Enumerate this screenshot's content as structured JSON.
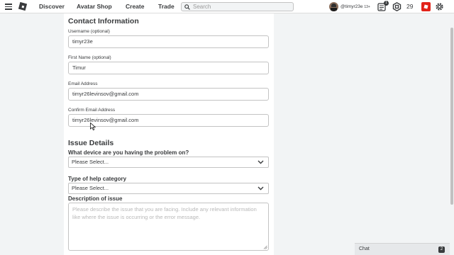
{
  "topbar": {
    "nav": [
      "Discover",
      "Avatar Shop",
      "Create",
      "Trade"
    ],
    "search_placeholder": "Search",
    "username": "@timyr23e",
    "age_label": "13+",
    "notification_count": "1",
    "robux": "29"
  },
  "contact": {
    "title": "Contact Information",
    "username_label": "Username (optional)",
    "username_value": "timyr23e",
    "first_name_label": "First Name (optional)",
    "first_name_value": "Timur",
    "email_label": "Email Address",
    "email_value": "timyr26levinsov@gmail.com",
    "confirm_email_label": "Confirm Email Address",
    "confirm_email_value": "timyr26levinsov@gmail.com"
  },
  "issue": {
    "title": "Issue Details",
    "device_question": "What device are you having the problem on?",
    "device_value": "Please Select...",
    "category_question": "Type of help category",
    "category_value": "Please Select...",
    "description_label": "Description of issue",
    "description_placeholder": "Please describe the issue that you are facing. Include any relevant information like where the issue is occurring or the error message."
  },
  "chat": {
    "label": "Chat",
    "count": "2"
  },
  "colors": {
    "background": "#f2f4f5",
    "card": "#ffffff",
    "text": "#393b3d",
    "border": "#c3c3c3",
    "premium_red": "#e2231a"
  }
}
